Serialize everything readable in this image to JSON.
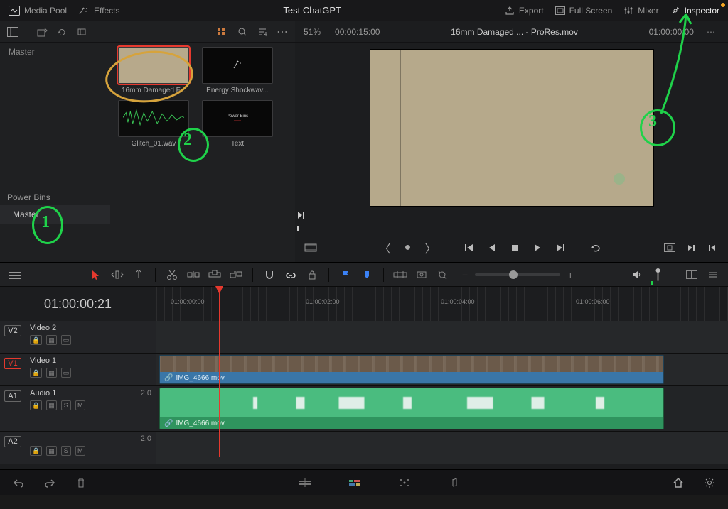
{
  "header": {
    "media_pool": "Media Pool",
    "effects": "Effects",
    "title": "Test ChatGPT",
    "export": "Export",
    "full_screen": "Full Screen",
    "mixer": "Mixer",
    "inspector": "Inspector"
  },
  "pool": {
    "master": "Master",
    "power_bins": "Power Bins",
    "power_master": "Master"
  },
  "clips": [
    {
      "name": "16mm Damaged F...",
      "kind": "tan",
      "selected": true
    },
    {
      "name": "Energy Shockwav...",
      "kind": "fx"
    },
    {
      "name": "Glitch_01.wav",
      "kind": "wave"
    },
    {
      "name": "Text",
      "kind": "text",
      "title_small": "Power Bins"
    }
  ],
  "viewer": {
    "zoom": "51%",
    "dur": "00:00:15:00",
    "name": "16mm Damaged ... - ProRes.mov",
    "tc": "01:00:00:00"
  },
  "timeline": {
    "tc": "01:00:00:21",
    "ticks": [
      "01:00:00:00",
      "01:00:02:00",
      "01:00:04:00",
      "01:00:06:00"
    ],
    "tracks": {
      "v2": {
        "tag": "V2",
        "name": "Video 2"
      },
      "v1": {
        "tag": "V1",
        "name": "Video 1"
      },
      "a1": {
        "tag": "A1",
        "name": "Audio 1",
        "meter": "2.0",
        "S": "S",
        "M": "M"
      },
      "a2": {
        "tag": "A2",
        "name": "",
        "meter": "2.0",
        "S": "S",
        "M": "M"
      }
    },
    "clip_video": "IMG_4666.mov",
    "clip_audio": "IMG_4666.mov"
  }
}
